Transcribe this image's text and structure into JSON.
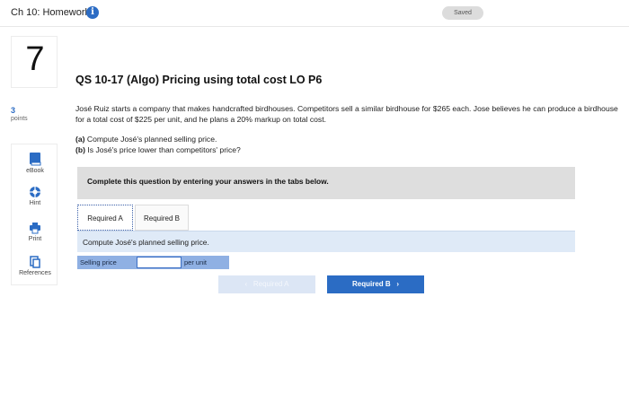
{
  "header": {
    "title": "Ch 10: Homework",
    "info_glyph": "i",
    "saved_label": "Saved"
  },
  "question": {
    "number": "7",
    "points_value": "3",
    "points_label": "points",
    "title": "QS 10-17 (Algo) Pricing using total cost LO P6",
    "body": "José Ruiz starts a company that makes handcrafted birdhouses. Competitors sell a similar birdhouse for $265 each. Jose believes he can produce a birdhouse for a total cost of $225 per unit, and he plans a 20% markup on total cost.",
    "part_a_tag": "(a)",
    "part_a_text": " Compute José's planned selling price.",
    "part_b_tag": "(b)",
    "part_b_text": " Is José's price lower than competitors' price?"
  },
  "tools": [
    {
      "label": "eBook",
      "icon": "book-icon"
    },
    {
      "label": "Hint",
      "icon": "lifebuoy-icon"
    },
    {
      "label": "Print",
      "icon": "printer-icon"
    },
    {
      "label": "References",
      "icon": "copy-icon"
    }
  ],
  "instructions": "Complete this question by entering your answers in the tabs below.",
  "tabs": [
    {
      "label": "Required A",
      "active": true
    },
    {
      "label": "Required B",
      "active": false
    }
  ],
  "panel": {
    "prompt": "Compute José's planned selling price.",
    "field_label": "Selling price",
    "field_value": "",
    "field_unit": "per unit"
  },
  "nav": {
    "prev_label": "Required A",
    "prev_glyph": "‹",
    "next_label": "Required B",
    "next_glyph": "›"
  },
  "colors": {
    "accent": "#2b6cc4",
    "panel_bg": "#dfeaf7",
    "input_row_bg": "#8fb0e3",
    "instructions_bg": "#dedede"
  }
}
